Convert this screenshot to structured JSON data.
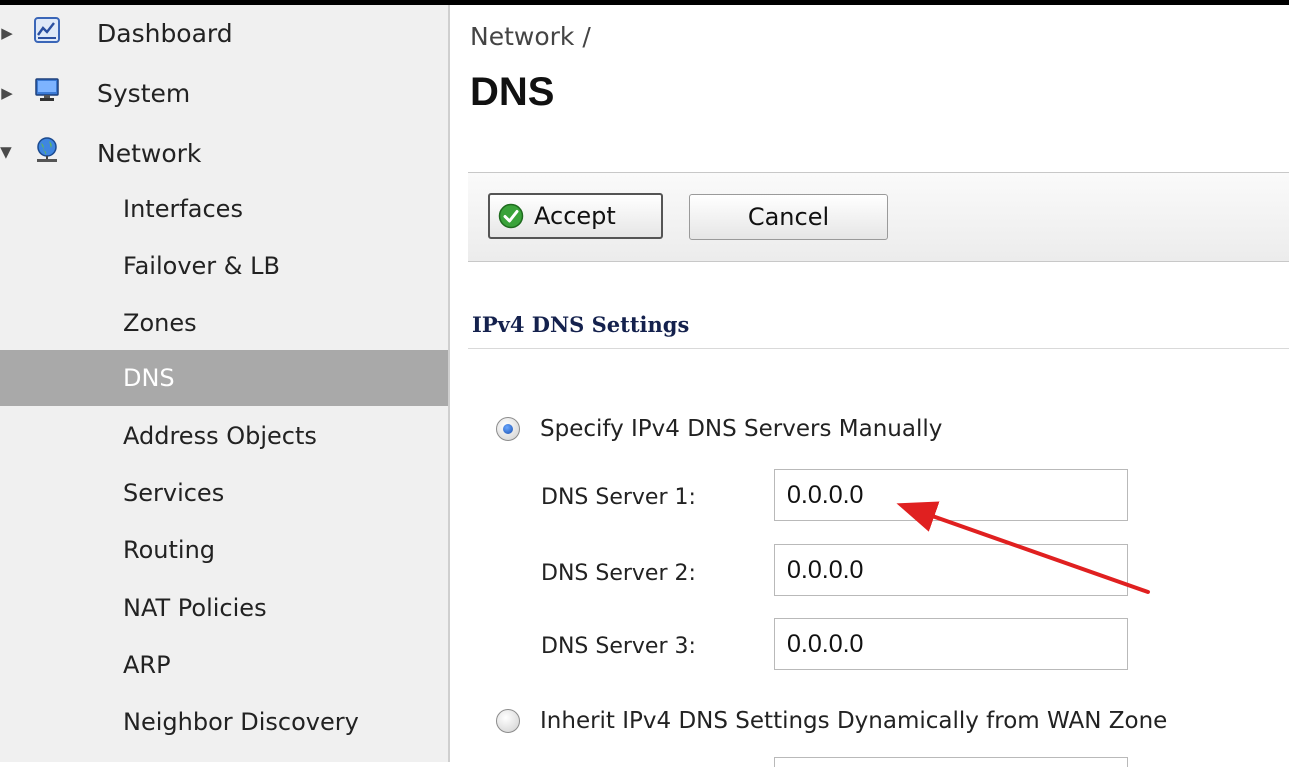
{
  "sidebar": {
    "top_items": [
      {
        "label": "Dashboard",
        "icon": "dashboard-chart-icon"
      },
      {
        "label": "System",
        "icon": "computer-monitor-icon"
      },
      {
        "label": "Network",
        "icon": "globe-network-icon"
      }
    ],
    "network_subitems": [
      {
        "label": "Interfaces"
      },
      {
        "label": "Failover & LB"
      },
      {
        "label": "Zones"
      },
      {
        "label": "DNS",
        "selected": true
      },
      {
        "label": "Address Objects"
      },
      {
        "label": "Services"
      },
      {
        "label": "Routing"
      },
      {
        "label": "NAT Policies"
      },
      {
        "label": "ARP"
      },
      {
        "label": "Neighbor Discovery"
      }
    ]
  },
  "main": {
    "breadcrumb": "Network /",
    "title": "DNS",
    "toolbar": {
      "accept_label": "Accept",
      "cancel_label": "Cancel"
    },
    "section_title": "IPv4 DNS Settings",
    "options": {
      "manual_label": "Specify IPv4 DNS Servers Manually",
      "manual_selected": true,
      "inherit_label": "Inherit IPv4 DNS Settings Dynamically from WAN Zone",
      "inherit_selected": false
    },
    "servers": [
      {
        "label": "DNS Server 1:",
        "value": "0.0.0.0"
      },
      {
        "label": "DNS Server 2:",
        "value": "0.0.0.0"
      },
      {
        "label": "DNS Server 3:",
        "value": "0.0.0.0"
      }
    ]
  },
  "colors": {
    "selected_row": "#a9a9a9",
    "section_title": "#14214d",
    "annotation_arrow": "#e02020"
  }
}
